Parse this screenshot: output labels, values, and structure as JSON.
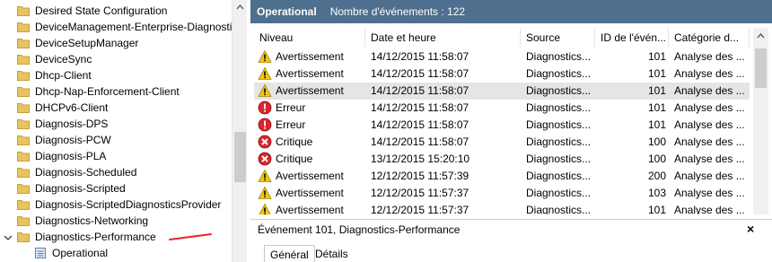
{
  "tree": {
    "items": [
      {
        "label": "Desired State Configuration"
      },
      {
        "label": "DeviceManagement-Enterprise-Diagnosti"
      },
      {
        "label": "DeviceSetupManager"
      },
      {
        "label": "DeviceSync"
      },
      {
        "label": "Dhcp-Client"
      },
      {
        "label": "Dhcp-Nap-Enforcement-Client"
      },
      {
        "label": "DHCPv6-Client"
      },
      {
        "label": "Diagnosis-DPS"
      },
      {
        "label": "Diagnosis-PCW"
      },
      {
        "label": "Diagnosis-PLA"
      },
      {
        "label": "Diagnosis-Scheduled"
      },
      {
        "label": "Diagnosis-Scripted"
      },
      {
        "label": "Diagnosis-ScriptedDiagnosticsProvider"
      },
      {
        "label": "Diagnostics-Networking"
      },
      {
        "label": "Diagnostics-Performance"
      }
    ],
    "child": {
      "label": "Operational"
    }
  },
  "header": {
    "title": "Operational",
    "count": "Nombre d'événements : 122"
  },
  "grid": {
    "columns": [
      "Niveau",
      "Date et heure",
      "Source",
      "ID de l'évén...",
      "Catégorie d..."
    ],
    "rows": [
      {
        "icon": "warning-icon",
        "level": "Avertissement",
        "date": "14/12/2015 11:58:07",
        "source": "Diagnostics...",
        "id": "101",
        "category": "Analyse des ..."
      },
      {
        "icon": "warning-icon",
        "level": "Avertissement",
        "date": "14/12/2015 11:58:07",
        "source": "Diagnostics...",
        "id": "101",
        "category": "Analyse des ..."
      },
      {
        "icon": "warning-icon",
        "level": "Avertissement",
        "date": "14/12/2015 11:58:07",
        "source": "Diagnostics...",
        "id": "101",
        "category": "Analyse des ...",
        "selected": true
      },
      {
        "icon": "error-icon",
        "level": "Erreur",
        "date": "14/12/2015 11:58:07",
        "source": "Diagnostics...",
        "id": "101",
        "category": "Analyse des ..."
      },
      {
        "icon": "error-icon",
        "level": "Erreur",
        "date": "14/12/2015 11:58:07",
        "source": "Diagnostics...",
        "id": "101",
        "category": "Analyse des ..."
      },
      {
        "icon": "critical-icon",
        "level": "Critique",
        "date": "14/12/2015 11:58:07",
        "source": "Diagnostics...",
        "id": "100",
        "category": "Analyse des ..."
      },
      {
        "icon": "critical-icon",
        "level": "Critique",
        "date": "13/12/2015 15:20:10",
        "source": "Diagnostics...",
        "id": "100",
        "category": "Analyse des ..."
      },
      {
        "icon": "warning-icon",
        "level": "Avertissement",
        "date": "12/12/2015 11:57:39",
        "source": "Diagnostics...",
        "id": "200",
        "category": "Analyse des ..."
      },
      {
        "icon": "warning-icon",
        "level": "Avertissement",
        "date": "12/12/2015 11:57:37",
        "source": "Diagnostics...",
        "id": "103",
        "category": "Analyse des ..."
      },
      {
        "icon": "warning-icon",
        "level": "Avertissement",
        "date": "12/12/2015 11:57:37",
        "source": "Diagnostics...",
        "id": "101",
        "category": "Analyse des ..."
      }
    ]
  },
  "detail": {
    "title": "Événement 101, Diagnostics-Performance",
    "close": "×",
    "tabs": [
      "Général",
      "Détails"
    ]
  },
  "colors": {
    "header_bg": "#4e6f8e",
    "warning": "#f2c811",
    "error": "#d9262c",
    "folder": "#e8c35f",
    "annotation": "#e8262a"
  }
}
